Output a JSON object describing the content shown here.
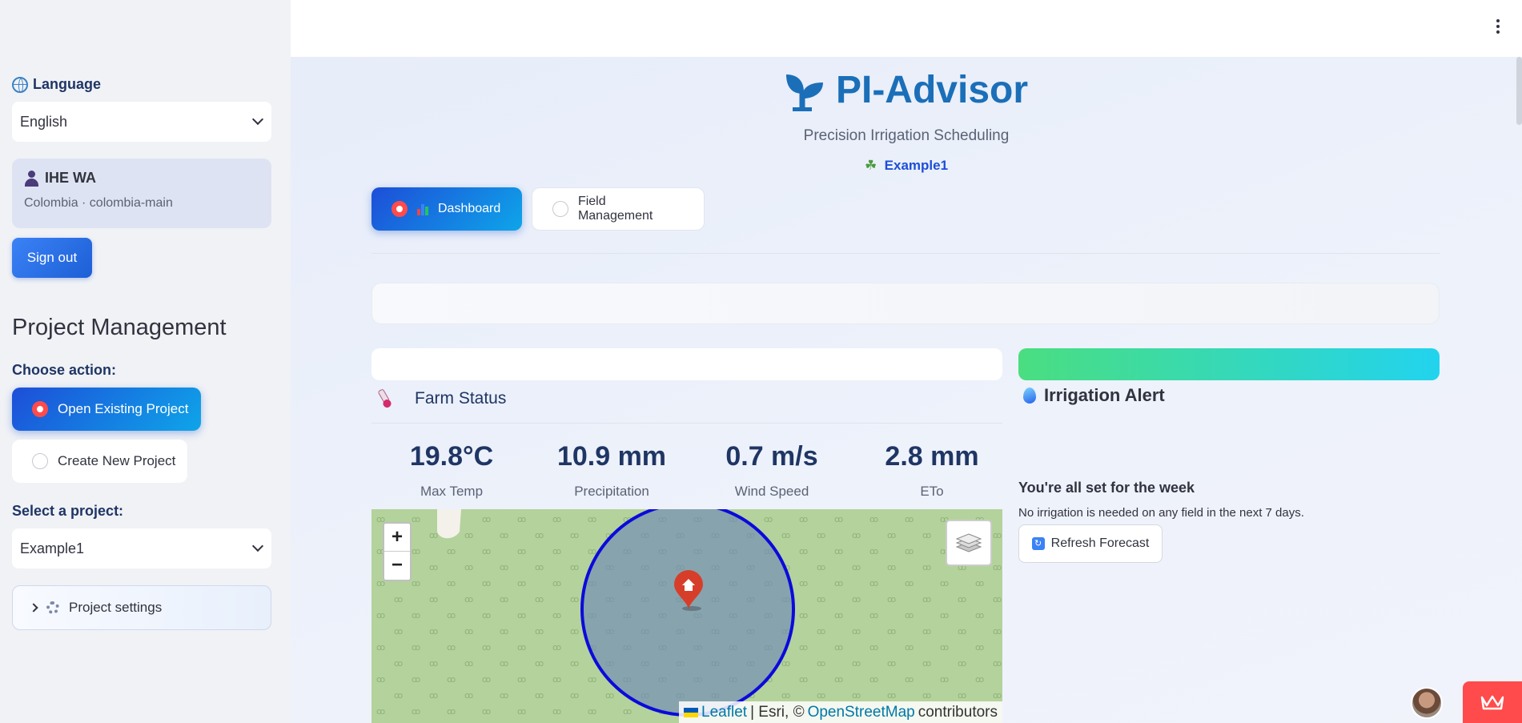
{
  "sidebar": {
    "language_label": "Language",
    "language_value": "English",
    "user_name": "IHE WA",
    "user_sub": "Colombia · colombia-main",
    "sign_out": "Sign out",
    "pm_title": "Project Management",
    "choose_action": "Choose action:",
    "action_open": "Open Existing Project",
    "action_create": "Create New Project",
    "select_project_label": "Select a project:",
    "project_value": "Example1",
    "project_settings": "Project settings"
  },
  "header": {
    "app_title": "PI-Advisor",
    "tagline": "Precision Irrigation Scheduling",
    "project_tag": "Example1"
  },
  "tabs": [
    {
      "label": "Dashboard"
    },
    {
      "label": "Field Management"
    }
  ],
  "farm": {
    "title": "Farm Status",
    "metrics": [
      {
        "value": "19.8°C",
        "label": "Max Temp"
      },
      {
        "value": "10.9 mm",
        "label": "Precipitation"
      },
      {
        "value": "0.7 m/s",
        "label": "Wind Speed"
      },
      {
        "value": "2.8 mm",
        "label": "ETo"
      }
    ]
  },
  "alert": {
    "title": "Irrigation Alert",
    "headline": "You're all set for the week",
    "text": "No irrigation is needed on any field in the next 7 days.",
    "refresh": "Refresh Forecast"
  },
  "map": {
    "zoom_in": "+",
    "zoom_out": "−",
    "attrib_leaflet": "Leaflet",
    "attrib_sep": "| Esri, ©",
    "attrib_osm": "OpenStreetMap",
    "attrib_tail": "contributors"
  },
  "colors": {
    "accent": "#1d4ed8",
    "brand": "#1b6fb8",
    "radio_on": "#ff4b4b",
    "map_bg": "#b4d29c",
    "circle": "#0a0adc"
  }
}
